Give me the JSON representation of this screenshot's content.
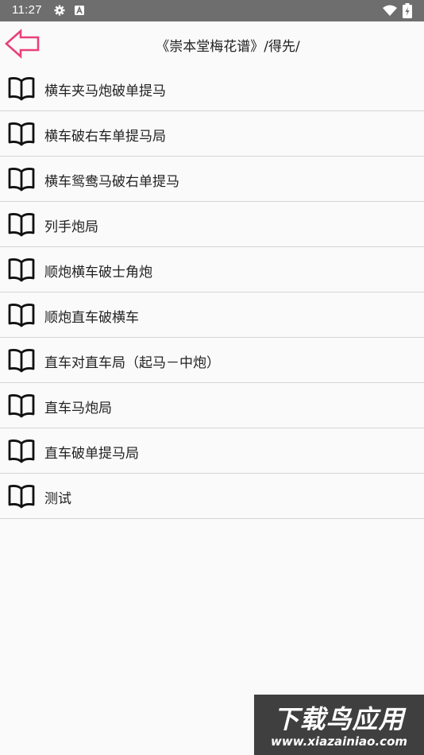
{
  "status_bar": {
    "time": "11:27",
    "icons": [
      "gear-icon",
      "a-notification-icon",
      "wifi-icon",
      "battery-charging-icon"
    ],
    "background": "#6e6e6e"
  },
  "header": {
    "back_icon": "arrow-left-icon",
    "back_color": "#e8407a",
    "title": "《崇本堂梅花谱》/得先/"
  },
  "list": {
    "item_icon": "book-open-icon",
    "items": [
      {
        "label": "横车夹马炮破单提马"
      },
      {
        "label": "横车破右车单提马局"
      },
      {
        "label": "横车鸳鸯马破右单提马"
      },
      {
        "label": "列手炮局"
      },
      {
        "label": "顺炮横车破士角炮"
      },
      {
        "label": "顺炮直车破横车"
      },
      {
        "label": "直车对直车局（起马－中炮）"
      },
      {
        "label": "直车马炮局"
      },
      {
        "label": "直车破单提马局"
      },
      {
        "label": "测试"
      }
    ]
  },
  "watermark": {
    "title": "下载鸟应用",
    "url": "www.xiazainiao.com"
  }
}
